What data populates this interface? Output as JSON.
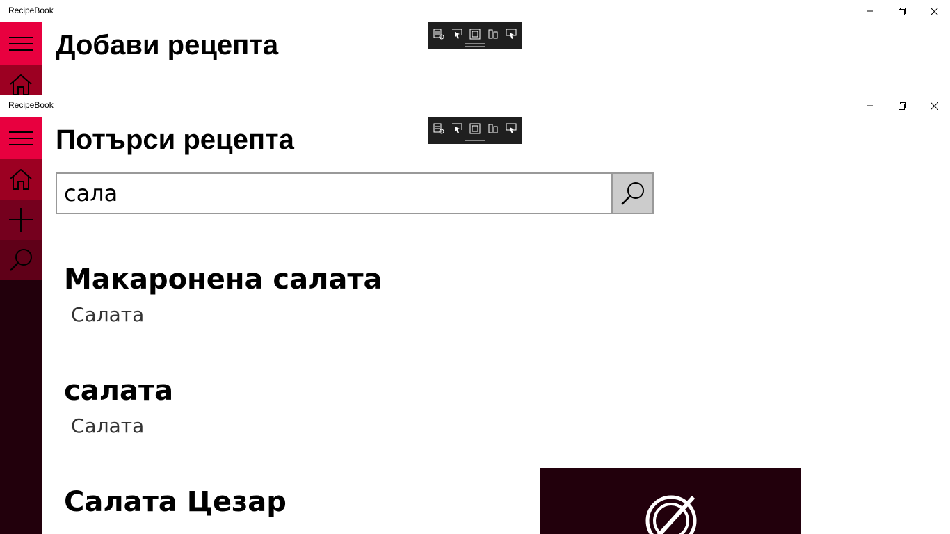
{
  "back_window": {
    "app_title": "RecipeBook",
    "page_title": "Добави рецепта",
    "nav": [
      "menu-icon",
      "home-icon"
    ]
  },
  "front_window": {
    "app_title": "RecipeBook",
    "page_title": "Потърси рецепта",
    "nav": [
      "menu-icon",
      "home-icon",
      "plus-icon",
      "search-icon"
    ],
    "search": {
      "value": "сала",
      "placeholder": "",
      "button_icon": "search-icon"
    },
    "results": [
      {
        "title": "Макаронена салата",
        "category": "Салата"
      },
      {
        "title": "салата",
        "category": "Салата"
      },
      {
        "title": "Салата Цезар",
        "category": ""
      }
    ],
    "thumbnail_icon": "no-image-plate-icon"
  },
  "window_controls": [
    "minimize-icon",
    "restore-icon",
    "close-icon"
  ],
  "debug_toolbar_icons": [
    "live-visual-tree-icon",
    "select-element-icon",
    "display-layout-adorners-icon",
    "track-focus-icon",
    "preview-selection-icon"
  ],
  "colors": {
    "accent": "#e8003f",
    "nav_home": "#9c0022",
    "nav_add": "#75001e",
    "nav_search": "#5f0018",
    "sidebar_bg": "#22000c",
    "toolbar_bg": "#1f1f1f"
  }
}
